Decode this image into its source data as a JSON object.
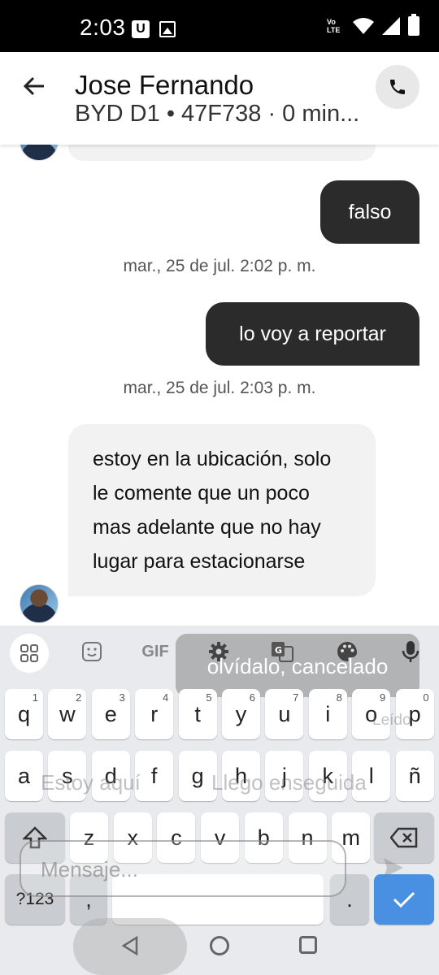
{
  "status_bar": {
    "time": "2:03",
    "volte": "Vo LTE"
  },
  "header": {
    "name": "Jose Fernando",
    "subtitle": "BYD D1 • 47F738 · 0 min..."
  },
  "messages": {
    "out1": "falso",
    "ts1": "mar., 25 de jul. 2:02 p. m.",
    "out2": "lo voy a reportar",
    "ts2": "mar., 25 de jul. 2:03 p. m.",
    "in1": "estoy en la ubicación, solo le comente que un poco mas adelante que no hay lugar para estacionarse"
  },
  "keyboard": {
    "toolbar_gif": "GIF",
    "suggestion_popup": "olvídalo, cancelado",
    "row1": [
      [
        "q",
        "1"
      ],
      [
        "w",
        "2"
      ],
      [
        "e",
        "3"
      ],
      [
        "r",
        "4"
      ],
      [
        "t",
        "5"
      ],
      [
        "y",
        "6"
      ],
      [
        "u",
        "7"
      ],
      [
        "i",
        "8"
      ],
      [
        "o",
        "9"
      ],
      [
        "p",
        "0"
      ]
    ],
    "row2": [
      "a",
      "s",
      "d",
      "f",
      "g",
      "h",
      "j",
      "k",
      "l",
      "ñ"
    ],
    "row3": [
      "z",
      "x",
      "c",
      "v",
      "b",
      "n",
      "m"
    ],
    "symbols_key": "?123",
    "comma_key": ",",
    "period_key": "."
  },
  "overlay": {
    "quick_reply_1": "Estoy aquí",
    "quick_reply_2": "Llego enseguida",
    "read_status": "Leído",
    "message_placeholder": "Mensaje..."
  }
}
